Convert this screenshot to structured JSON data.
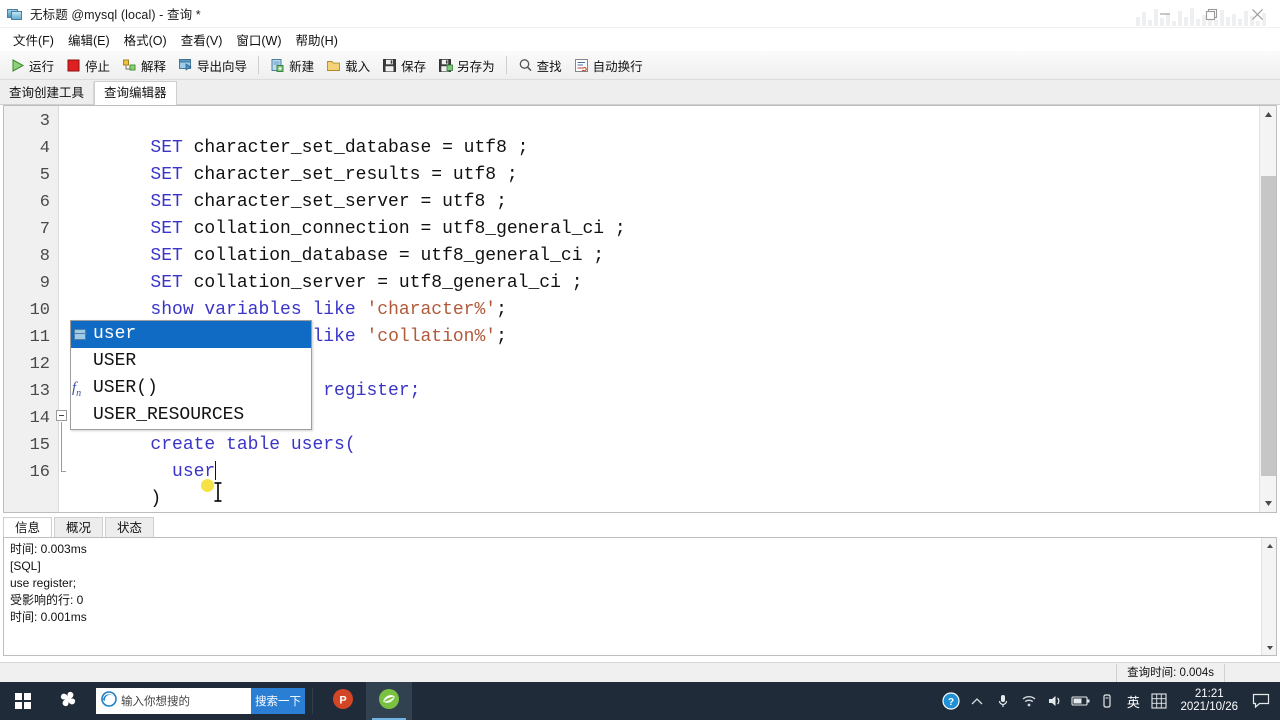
{
  "window": {
    "title": "无标题 @mysql (local) - 查询 *",
    "icon": "navicat-query-icon",
    "controls": {
      "minimize": "—",
      "restore": "❐",
      "close": "✕"
    }
  },
  "menubar": [
    {
      "name": "file",
      "label": "文件(F)"
    },
    {
      "name": "edit",
      "label": "编辑(E)"
    },
    {
      "name": "format",
      "label": "格式(O)"
    },
    {
      "name": "view",
      "label": "查看(V)"
    },
    {
      "name": "window",
      "label": "窗口(W)"
    },
    {
      "name": "help",
      "label": "帮助(H)"
    }
  ],
  "toolbar": [
    {
      "name": "run",
      "label": "运行",
      "icon": "play-icon"
    },
    {
      "name": "stop",
      "label": "停止",
      "icon": "stop-icon"
    },
    {
      "name": "explain",
      "label": "解释",
      "icon": "explain-icon"
    },
    {
      "name": "export-wizard",
      "label": "导出向导",
      "icon": "export-icon"
    },
    {
      "name": "new",
      "label": "新建",
      "icon": "new-document-icon"
    },
    {
      "name": "load",
      "label": "载入",
      "icon": "folder-open-icon"
    },
    {
      "name": "save",
      "label": "保存",
      "icon": "save-floppy-icon"
    },
    {
      "name": "save-as",
      "label": "另存为",
      "icon": "save-as-floppy-icon"
    },
    {
      "name": "find",
      "label": "查找",
      "icon": "search-magnifier-icon"
    },
    {
      "name": "word-wrap",
      "label": "自动换行",
      "icon": "word-wrap-icon"
    }
  ],
  "editor_tabs": [
    {
      "name": "query-builder",
      "label": "查询创建工具",
      "active": false
    },
    {
      "name": "query-editor",
      "label": "查询编辑器",
      "active": true
    }
  ],
  "code": {
    "first_line_number": 3,
    "lines": [
      {
        "n": 3,
        "segments": [
          {
            "t": "SET",
            "c": "kw"
          },
          {
            "t": " character_set_database = utf8 ;",
            "c": "pl"
          }
        ]
      },
      {
        "n": 4,
        "segments": [
          {
            "t": "SET",
            "c": "kw"
          },
          {
            "t": " character_set_results = utf8 ;",
            "c": "pl"
          }
        ]
      },
      {
        "n": 5,
        "segments": [
          {
            "t": "SET",
            "c": "kw"
          },
          {
            "t": " character_set_server = utf8 ;",
            "c": "pl"
          }
        ]
      },
      {
        "n": 6,
        "segments": [
          {
            "t": "SET",
            "c": "kw"
          },
          {
            "t": " collation_connection = utf8_general_ci ;",
            "c": "pl"
          }
        ]
      },
      {
        "n": 7,
        "segments": [
          {
            "t": "SET",
            "c": "kw"
          },
          {
            "t": " collation_database = utf8_general_ci ;",
            "c": "pl"
          }
        ]
      },
      {
        "n": 8,
        "segments": [
          {
            "t": "SET",
            "c": "kw"
          },
          {
            "t": " collation_server = utf8_general_ci ;",
            "c": "pl"
          }
        ]
      },
      {
        "n": 9,
        "segments": [
          {
            "t": "show variables like ",
            "c": "kw"
          },
          {
            "t": "'character%'",
            "c": "str"
          },
          {
            "t": ";",
            "c": "pl"
          }
        ]
      },
      {
        "n": 10,
        "segments": [
          {
            "t": "show variables like ",
            "c": "kw"
          },
          {
            "t": "'collation%'",
            "c": "str"
          },
          {
            "t": ";",
            "c": "pl"
          }
        ]
      },
      {
        "n": 11,
        "segments": [
          {
            "t": "",
            "c": "pl"
          }
        ]
      },
      {
        "n": 12,
        "segments": [
          {
            "t": "create database register;",
            "c": "kw"
          }
        ]
      },
      {
        "n": 13,
        "segments": [
          {
            "t": "use register;",
            "c": "kw"
          }
        ]
      },
      {
        "n": 14,
        "segments": [
          {
            "t": "create table users(",
            "c": "kw"
          }
        ]
      },
      {
        "n": 15,
        "segments": [
          {
            "t": "  user",
            "c": "kw"
          }
        ]
      },
      {
        "n": 16,
        "segments": [
          {
            "t": ")",
            "c": "pl"
          }
        ]
      }
    ],
    "fold_marker_line": 14,
    "cursor_line": 15,
    "cursor_text": "user"
  },
  "autocomplete": {
    "visible": true,
    "items": [
      {
        "label": "user",
        "icon": "table-icon",
        "selected": true
      },
      {
        "label": "USER",
        "icon": "none",
        "selected": false
      },
      {
        "label": "USER()",
        "icon": "function-icon",
        "selected": false
      },
      {
        "label": "USER_RESOURCES",
        "icon": "none",
        "selected": false
      }
    ]
  },
  "result_panel": {
    "tabs": [
      {
        "name": "info",
        "label": "信息",
        "active": true
      },
      {
        "name": "profile",
        "label": "概况",
        "active": false
      },
      {
        "name": "status",
        "label": "状态",
        "active": false
      }
    ],
    "log_lines": [
      "时间: 0.003ms",
      "",
      "[SQL]",
      "use register;",
      "受影响的行: 0",
      "时间: 0.001ms"
    ]
  },
  "statusbar": {
    "query_time": "查询时间: 0.004s"
  },
  "taskbar": {
    "start_icon": "windows-start-icon",
    "pinned_icon": "pinwheel-icon",
    "search": {
      "icon": "edge-browser-icon",
      "placeholder": "输入你想搜的",
      "button_label": "搜索一下"
    },
    "apps": [
      {
        "name": "powerpoint",
        "icon": "powerpoint-icon",
        "active": false
      },
      {
        "name": "navicat",
        "icon": "navicat-icon",
        "active": true
      }
    ],
    "tray": [
      {
        "name": "help",
        "icon": "help-circle-icon"
      },
      {
        "name": "show-hidden",
        "icon": "chevron-up-icon"
      },
      {
        "name": "microphone",
        "icon": "microphone-icon"
      },
      {
        "name": "network",
        "icon": "wifi-icon"
      },
      {
        "name": "volume",
        "icon": "speaker-icon"
      },
      {
        "name": "battery",
        "icon": "battery-icon"
      },
      {
        "name": "usb",
        "icon": "usb-device-icon"
      },
      {
        "name": "ime-language",
        "icon": "ime-icon",
        "label": "英"
      },
      {
        "name": "ime-keyboard",
        "icon": "keyboard-grid-icon"
      }
    ],
    "clock": {
      "time": "21:21",
      "date": "2021/10/26"
    },
    "notifications_icon": "notification-balloon-icon"
  },
  "colors": {
    "keyword": "#3a35c8",
    "string": "#b05a3a",
    "plain": "#111111",
    "ac_selection": "#0f6bc4",
    "taskbar": "#1f2b38",
    "search_button": "#2a7fd4",
    "click_highlight": "#f5e03a"
  }
}
